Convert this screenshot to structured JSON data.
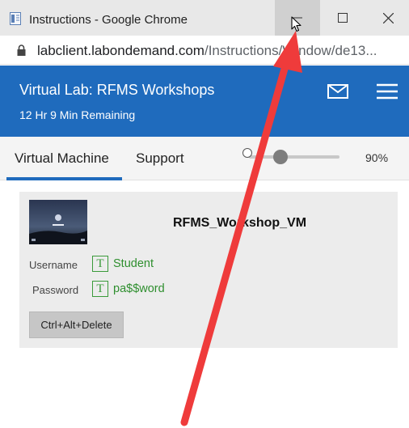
{
  "window": {
    "title": "Instructions - Google Chrome",
    "minimize_icon": "minimize-icon",
    "maximize_icon": "maximize-icon",
    "close_icon": "close-icon"
  },
  "address": {
    "domain": "labclient.labondemand.com",
    "path": "/Instructions/Window/de13..."
  },
  "header": {
    "title": "Virtual Lab: RFMS Workshops",
    "remaining": "12 Hr 9 Min Remaining",
    "mail_icon": "mail-icon",
    "menu_icon": "hamburger-menu-icon",
    "background": "#1f6bbd"
  },
  "tabs": {
    "items": [
      {
        "label": "Virtual Machine",
        "active": true
      },
      {
        "label": "Support",
        "active": false
      }
    ],
    "zoom": "90%"
  },
  "vm": {
    "name": "RFMS_Workshop_VM",
    "username_label": "Username",
    "username": "Student",
    "password_label": "Password",
    "password": "pa$$word",
    "text_icon_glyph": "T",
    "ctrl_alt_delete": "Ctrl+Alt+Delete"
  },
  "annotation": {
    "arrow_color": "#ef3b3b"
  }
}
